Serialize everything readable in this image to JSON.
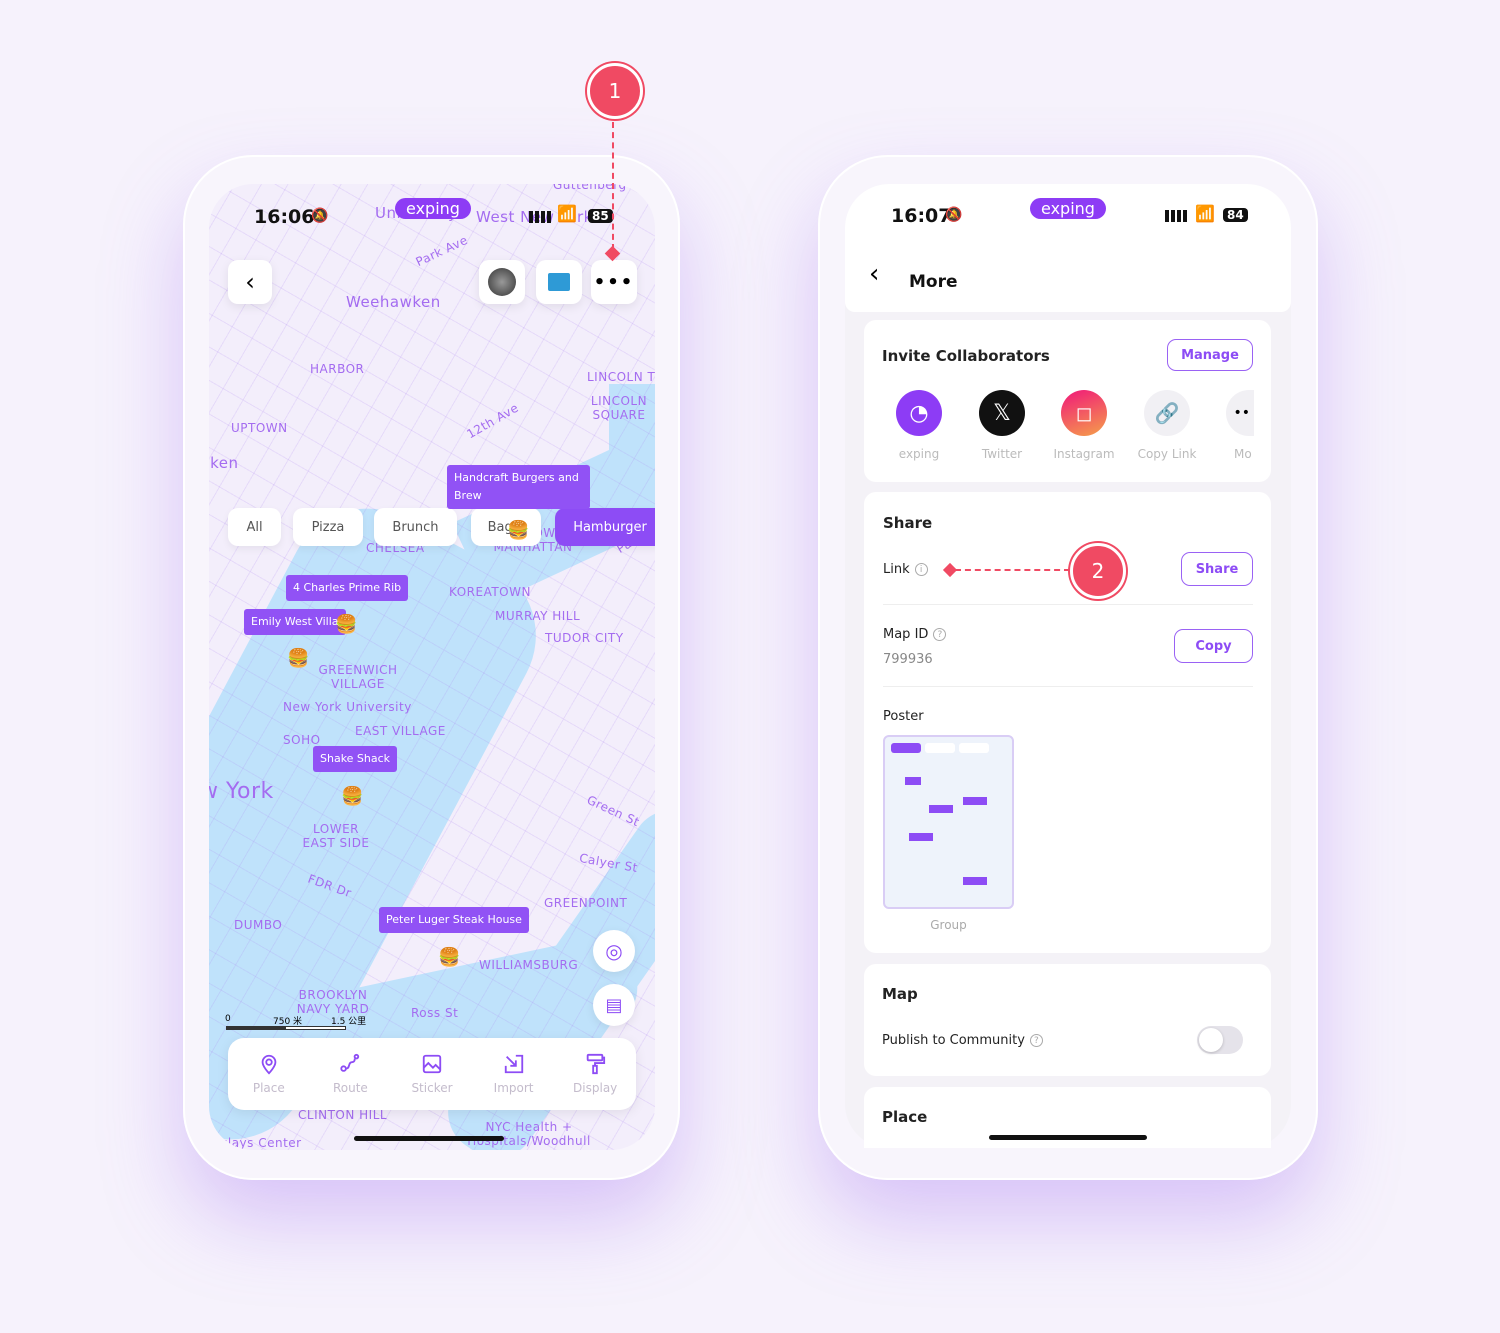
{
  "left": {
    "status": {
      "time": "16:06",
      "battery": "85",
      "brand": "exping"
    },
    "filters": [
      "All",
      "Pizza",
      "Brunch",
      "Bagel",
      "Hamburger"
    ],
    "active_filter": "Hamburger",
    "map_labels": [
      "Guttenberg",
      "Union City",
      "West New York",
      "Park Ave",
      "Weehawken",
      "HARBOR",
      "LINCOLN TOWERS",
      "LINCOLN SQUARE",
      "UPTOWN",
      "Hoboken",
      "12th Ave",
      "CHELSEA",
      "MIDTOWN MANHATTAN",
      "KOREATOWN",
      "MURRAY HILL",
      "TUDOR CITY",
      "GREENWICH VILLAGE",
      "New York University",
      "EAST VILLAGE",
      "SOHO",
      "New York",
      "LOWER EAST SIDE",
      "FDR Dr",
      "GREENPOINT",
      "DUMBO",
      "WILLIAMSBURG",
      "BROOKLYN NAVY YARD",
      "Ross St",
      "CLINTON HILL",
      "NYC Health + Hospitals/Woodhull",
      "Barclays Center",
      "Park Ave",
      "Green St",
      "Calyer St"
    ],
    "places": [
      "Handcraft Burgers and Brew",
      "4 Charles Prime Rib",
      "Emily West Villa",
      "Shake Shack",
      "Peter Luger Steak House"
    ],
    "scale": {
      "zero": "0",
      "mid": "750 米",
      "max": "1.5 公里"
    },
    "toolbar": [
      "Place",
      "Route",
      "Sticker",
      "Import",
      "Display"
    ],
    "annotation": "1"
  },
  "right": {
    "status": {
      "time": "16:07",
      "battery": "84",
      "brand": "exping"
    },
    "title": "More",
    "invite": {
      "heading": "Invite Collaborators",
      "manage": "Manage",
      "apps": [
        "exping",
        "Twitter",
        "Instagram",
        "Copy Link",
        "Mo"
      ]
    },
    "share": {
      "heading": "Share",
      "link_label": "Link",
      "share_button": "Share",
      "map_id_label": "Map ID",
      "map_id": "799936",
      "copy_button": "Copy",
      "poster_label": "Poster",
      "poster_caption": "Group"
    },
    "map": {
      "heading": "Map",
      "publish_label": "Publish to Community",
      "publish_on": false
    },
    "place": {
      "heading": "Place"
    },
    "annotation": "2"
  },
  "colors": {
    "accent": "#8d4cf5",
    "annotation": "#f04a63",
    "water": "#bfe2fb"
  }
}
